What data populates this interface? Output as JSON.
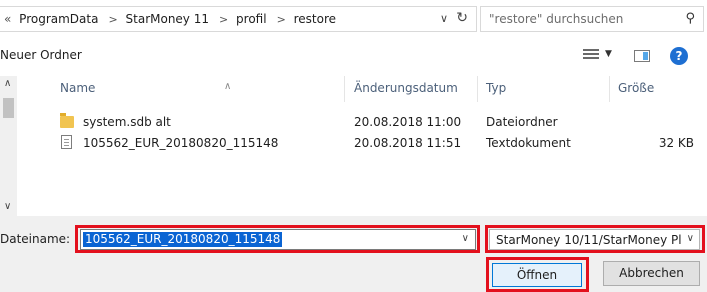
{
  "address": {
    "back_glyph": "«",
    "crumbs": [
      "ProgramData",
      "StarMoney 11",
      "profil",
      "restore"
    ]
  },
  "search": {
    "placeholder": "\"restore\" durchsuchen"
  },
  "toolbar": {
    "new_folder_label": "Neuer Ordner"
  },
  "columns": {
    "name": "Name",
    "date": "Änderungsdatum",
    "type": "Typ",
    "size": "Größe"
  },
  "files": [
    {
      "name": "system.sdb alt",
      "date": "20.08.2018 11:00",
      "type": "Dateiordner",
      "size": "",
      "icon": "folder-icon"
    },
    {
      "name": "105562_EUR_20180820_115148",
      "date": "20.08.2018 11:51",
      "type": "Textdokument",
      "size": "32 KB",
      "icon": "text-document-icon"
    }
  ],
  "bottom": {
    "filename_label": "Dateiname:",
    "filename_value": "105562_EUR_20180820_115148",
    "filetype_value": "StarMoney 10/11/StarMoney Pl",
    "open_label": "Öffnen",
    "cancel_label": "Abbrechen"
  },
  "colors": {
    "highlight": "#e3101d",
    "selection": "#0a64d3",
    "help": "#1e6fd2"
  }
}
